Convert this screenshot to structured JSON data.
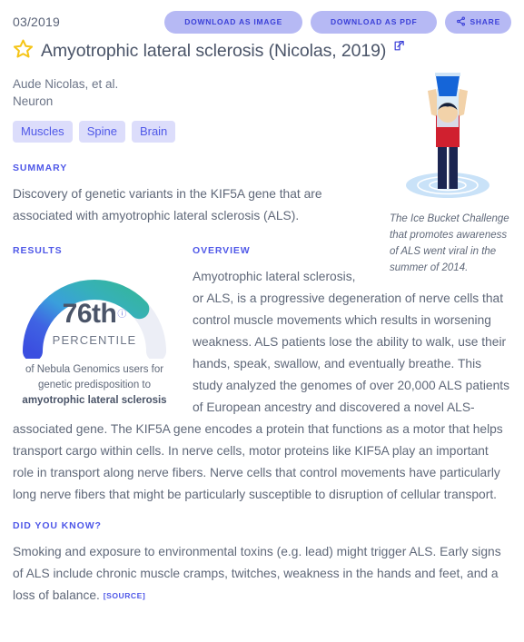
{
  "header": {
    "publication_date": "03/2019",
    "actions": [
      {
        "label": "DOWNLOAD AS IMAGE",
        "icon": "download-icon"
      },
      {
        "label": "DOWNLOAD AS PDF",
        "icon": "download-icon"
      },
      {
        "label": "SHARE",
        "icon": "share-icon"
      }
    ]
  },
  "article": {
    "star_icon": "star-icon",
    "title": "Amyotrophic lateral sclerosis (Nicolas, 2019)",
    "external_link_icon": "external-link-icon",
    "authors": "Aude Nicolas, et al.",
    "journal": "Neuron",
    "tags": [
      "Muscles",
      "Spine",
      "Brain"
    ]
  },
  "summary": {
    "heading": "SUMMARY",
    "text": "Discovery of genetic variants in the KIF5A gene that are associated with amyotrophic lateral sclerosis (ALS)."
  },
  "results": {
    "heading": "RESULTS",
    "gauge": {
      "value": "76th",
      "info_icon": "info-circle-icon",
      "unit_label": "PERCENTILE",
      "description_prefix": "of Nebula Genomics users for genetic predisposition to ",
      "description_emphasis": "amyotrophic lateral sclerosis",
      "percentile": 76,
      "colors": {
        "arc_start": "#3b53e0",
        "arc_mid": "#3aa9e0",
        "arc_end": "#35b3a4",
        "arc_track": "#eceef6"
      }
    }
  },
  "overview": {
    "heading": "OVERVIEW",
    "text": "Amyotrophic lateral sclerosis, or ALS, is a progressive degeneration of nerve cells that control muscle movements which results in worsening weakness. ALS patients lose the ability to walk, use their hands, speak, swallow, and eventually breathe. This study analyzed the genomes of over 20,000 ALS patients of European ancestry and discovered a novel ALS-associated gene. The KIF5A gene encodes a protein that functions as a motor that helps transport cargo within cells. In nerve cells, motor proteins like KIF5A play an important role in transport along nerve fibers. Nerve cells that control movements have particularly long nerve fibers that might be particularly susceptible to disruption of cellular transport."
  },
  "illustration": {
    "name": "ice-bucket-challenge-illustration",
    "caption": "The Ice Bucket Challenge that promotes awareness of ALS went viral in the summer of 2014.",
    "colors": {
      "bucket": "#1565d8",
      "shirt": "#d0202f",
      "pants": "#1b2551",
      "skin": "#f2d2a9",
      "hair": "#14213d",
      "water": "#b8d9f5"
    }
  },
  "did_you_know": {
    "heading": "DID YOU KNOW?",
    "text": "Smoking and exposure to environmental toxins (e.g. lead) might trigger ALS. Early signs of ALS include chronic muscle cramps, twitches, weakness in the hands and feet, and a loss of balance.",
    "source_label": "[SOURCE]"
  }
}
